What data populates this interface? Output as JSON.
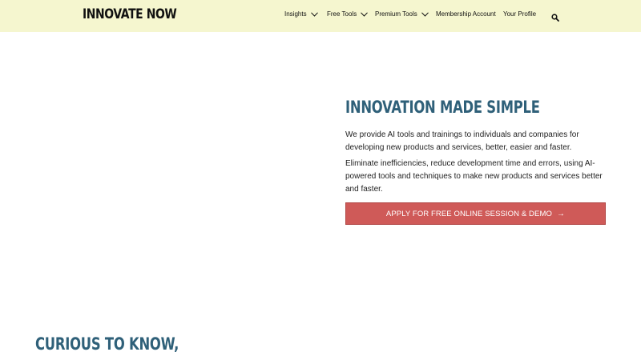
{
  "header": {
    "logo": "INNOVATE NOW",
    "nav": [
      {
        "label": "Insights",
        "has_dropdown": true
      },
      {
        "label": "Free Tools",
        "has_dropdown": true
      },
      {
        "label": "Premium Tools",
        "has_dropdown": true
      },
      {
        "label": "Membership Account",
        "has_dropdown": false
      },
      {
        "label": "Your Profile",
        "has_dropdown": false
      }
    ],
    "search_icon": "search-icon",
    "background_color": "#f5f6cf"
  },
  "hero": {
    "title": "INNOVATION MADE SIMPLE",
    "paragraph1": "We provide AI tools and trainings to individuals and companies for developing new products and services, better, easier and faster.",
    "paragraph2": "Eliminate inefficiencies, reduce development time and errors, using AI-powered tools and techniques to make new products and services better and faster.",
    "cta_label": "APPLY FOR FREE ONLINE SESSION & DEMO",
    "cta_arrow": "→",
    "title_color": "#2f6079",
    "cta_color": "#cf5a58"
  },
  "section": {
    "heading": "CURIOUS TO KNOW,"
  }
}
